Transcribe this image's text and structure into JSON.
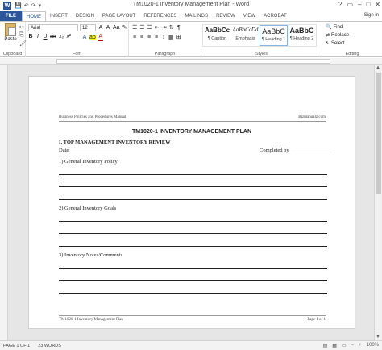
{
  "window": {
    "title": "TM1020-1 Inventory Management Plan - Word",
    "app_letter": "W",
    "controls": [
      "?",
      "▭",
      "–",
      "□",
      "✕"
    ]
  },
  "qat": [
    "💾",
    "↶",
    "↷",
    "▾"
  ],
  "tabs": [
    "FILE",
    "HOME",
    "INSERT",
    "DESIGN",
    "PAGE LAYOUT",
    "REFERENCES",
    "MAILINGS",
    "REVIEW",
    "VIEW",
    "ACROBAT"
  ],
  "signin": "Sign in",
  "ribbon": {
    "clipboard": {
      "paste": "Paste",
      "label": "Clipboard"
    },
    "font": {
      "name": "Arial",
      "size": "12",
      "row1": [
        "A",
        "A",
        "Aa",
        "✎"
      ],
      "row2": [
        "B",
        "I",
        "U",
        "abc",
        "x₂",
        "x²"
      ],
      "row3": [
        "A",
        "ab",
        "A"
      ],
      "label": "Font"
    },
    "paragraph": {
      "row1": [
        "☰",
        "☰",
        "☰",
        "⇤",
        "⇥",
        "⇅",
        "¶"
      ],
      "row2": [
        "≡",
        "≡",
        "≡",
        "≡",
        "↕",
        "▦",
        "⊞"
      ],
      "label": "Paragraph"
    },
    "styles": {
      "items": [
        {
          "sample": "AaBbCc",
          "name": "¶ Caption"
        },
        {
          "sample": "AaBbCcDd",
          "name": "Emphasis"
        },
        {
          "sample": "AaBbC",
          "name": "¶ Heading 1"
        },
        {
          "sample": "AaBbC",
          "name": "¶ Heading 2"
        }
      ],
      "label": "Styles"
    },
    "editing": {
      "find": "Find",
      "replace": "Replace",
      "select": "Select",
      "label": "Editing"
    }
  },
  "document": {
    "header_left": "Business Policies and Procedures Manual",
    "header_right": "Bizmanualz.com",
    "title": "TM1020-1 INVENTORY MANAGEMENT PLAN",
    "section": "I.  TOP MANAGEMENT INVENTORY REVIEW",
    "date_label": "Date ____________________",
    "completed_label": "Completed by ________________",
    "items": [
      "1) General Inventory Policy",
      "2) General Inventory Goals",
      "3) Inventory Notes/Comments"
    ],
    "footer_left": "TM1020-1 Inventory Management Plan",
    "footer_right": "Page 1 of 1"
  },
  "status": {
    "page": "PAGE 1 OF 1",
    "words": "23 WORDS",
    "icons": [
      "▤",
      "▦",
      "▭",
      "−",
      "+"
    ],
    "zoom": "100%"
  }
}
